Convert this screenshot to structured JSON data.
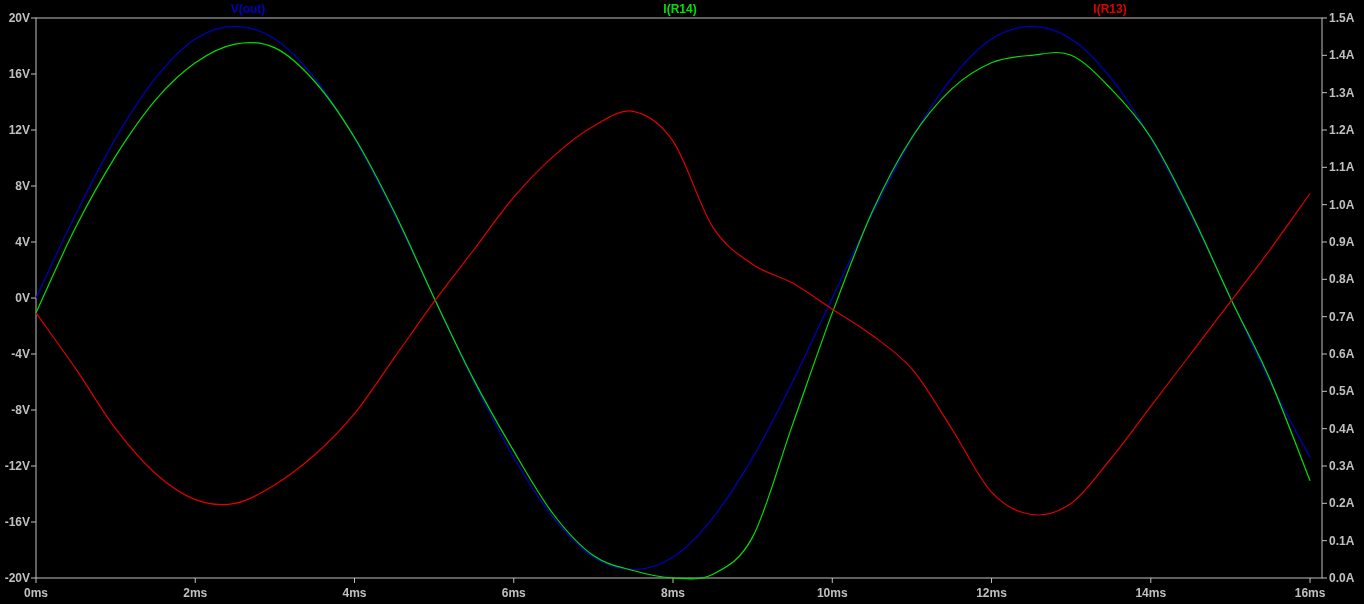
{
  "chart_data": {
    "type": "line",
    "xlim": [
      0,
      16.15
    ],
    "ylim": [
      -20,
      20
    ],
    "y2lim": [
      0,
      1.5
    ],
    "x": [
      0,
      0.5,
      1,
      1.5,
      2,
      2.5,
      3,
      3.5,
      4,
      4.5,
      5,
      5.5,
      6,
      6.5,
      7,
      7.5,
      8,
      8.5,
      9,
      9.5,
      10,
      10.5,
      11,
      11.5,
      12,
      12.5,
      13,
      13.5,
      14,
      14.5,
      15,
      15.5,
      16
    ],
    "xticks": [
      {
        "value": 0,
        "label": "0ms"
      },
      {
        "value": 2,
        "label": "2ms"
      },
      {
        "value": 4,
        "label": "4ms"
      },
      {
        "value": 6,
        "label": "6ms"
      },
      {
        "value": 8,
        "label": "8ms"
      },
      {
        "value": 10,
        "label": "10ms"
      },
      {
        "value": 12,
        "label": "12ms"
      },
      {
        "value": 14,
        "label": "14ms"
      },
      {
        "value": 16,
        "label": "16ms"
      }
    ],
    "yticks": [
      {
        "value": 20,
        "label": "20V"
      },
      {
        "value": 16,
        "label": "16V"
      },
      {
        "value": 12,
        "label": "12V"
      },
      {
        "value": 8,
        "label": "8V"
      },
      {
        "value": 4,
        "label": "4V"
      },
      {
        "value": 0,
        "label": "0V"
      },
      {
        "value": -4,
        "label": "-4V"
      },
      {
        "value": -8,
        "label": "-8V"
      },
      {
        "value": -12,
        "label": "-12V"
      },
      {
        "value": -16,
        "label": "-16V"
      },
      {
        "value": -20,
        "label": "-20V"
      }
    ],
    "y2ticks": [
      {
        "value": 1.5,
        "label": "1.5A"
      },
      {
        "value": 1.4,
        "label": "1.4A"
      },
      {
        "value": 1.3,
        "label": "1.3A"
      },
      {
        "value": 1.2,
        "label": "1.2A"
      },
      {
        "value": 1.1,
        "label": "1.1A"
      },
      {
        "value": 1.0,
        "label": "1.0A"
      },
      {
        "value": 0.9,
        "label": "0.9A"
      },
      {
        "value": 0.8,
        "label": "0.8A"
      },
      {
        "value": 0.7,
        "label": "0.7A"
      },
      {
        "value": 0.6,
        "label": "0.6A"
      },
      {
        "value": 0.5,
        "label": "0.5A"
      },
      {
        "value": 0.4,
        "label": "0.4A"
      },
      {
        "value": 0.3,
        "label": "0.3A"
      },
      {
        "value": 0.2,
        "label": "0.2A"
      },
      {
        "value": 0.1,
        "label": "0.1A"
      },
      {
        "value": 0.0,
        "label": "0.0A"
      }
    ],
    "series": [
      {
        "name": "V(out)",
        "color": "#0000c0",
        "values": [
          0,
          6.0,
          11.4,
          15.7,
          18.5,
          19.4,
          18.5,
          15.7,
          11.4,
          6.0,
          0,
          -6.0,
          -11.4,
          -15.7,
          -18.5,
          -19.4,
          -18.5,
          -15.7,
          -11.4,
          -6.0,
          0,
          6.0,
          11.4,
          15.7,
          18.5,
          19.4,
          18.5,
          15.7,
          11.4,
          6.0,
          0,
          -6.0,
          -11.4
        ]
      },
      {
        "name": "I(R14)",
        "color": "#00e000",
        "axis": "y2",
        "values": [
          0.71,
          0.94,
          1.13,
          1.28,
          1.38,
          1.43,
          1.42,
          1.33,
          1.18,
          0.98,
          0.75,
          0.53,
          0.34,
          0.17,
          0.06,
          0.02,
          0.0,
          0.01,
          0.11,
          0.41,
          0.71,
          0.98,
          1.18,
          1.31,
          1.38,
          1.4,
          1.4,
          1.31,
          1.18,
          0.98,
          0.75,
          0.53,
          0.26
        ]
      },
      {
        "name": "I(R13)",
        "color": "#e00000",
        "axis": "y2",
        "values": [
          0.71,
          0.56,
          0.4,
          0.28,
          0.21,
          0.2,
          0.25,
          0.33,
          0.44,
          0.59,
          0.74,
          0.88,
          1.02,
          1.13,
          1.21,
          1.25,
          1.17,
          0.94,
          0.84,
          0.79,
          0.72,
          0.65,
          0.56,
          0.4,
          0.23,
          0.17,
          0.2,
          0.32,
          0.46,
          0.6,
          0.74,
          0.88,
          1.03
        ]
      }
    ]
  }
}
